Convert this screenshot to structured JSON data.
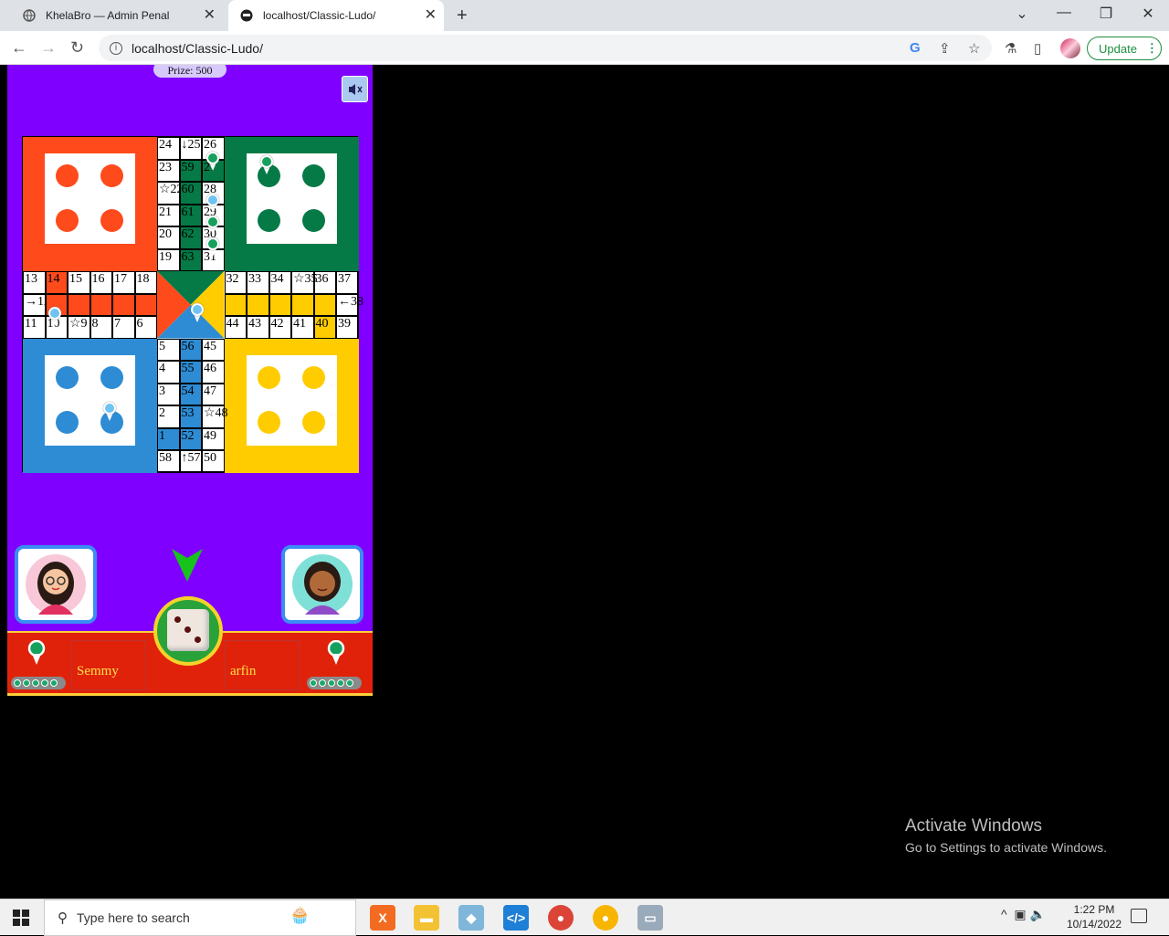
{
  "browser": {
    "tabs": [
      {
        "title": "KhelaBro — Admin Penal",
        "active": false
      },
      {
        "title": "localhost/Classic-Ludo/",
        "active": true
      }
    ],
    "url": "localhost/Classic-Ludo/",
    "update_label": "Update",
    "new_tab": "+",
    "minimize": "—",
    "maximize": "❐",
    "close": "✕"
  },
  "game": {
    "prize_label": "Prize: 500",
    "colors": {
      "red": "#ff4a1c",
      "green": "#057a46",
      "blue": "#2d8cd4",
      "yellow": "#ffcc00",
      "background": "#7f00ff"
    },
    "cells": {
      "top_col1": [
        "24",
        "23",
        "☆22",
        "21",
        "20",
        "19"
      ],
      "top_col2": [
        "↓25",
        "59",
        "60",
        "61",
        "62",
        "63"
      ],
      "top_col3": [
        "26",
        "27",
        "28",
        "29",
        "30",
        "31"
      ],
      "left_row1": [
        "13",
        "14",
        "15",
        "16",
        "17",
        "18"
      ],
      "left_row2": [
        "→12",
        "",
        "",
        "",
        "",
        ""
      ],
      "left_row3": [
        "11",
        "10",
        "☆9",
        "8",
        "7",
        "6"
      ],
      "right_row1": [
        "32",
        "33",
        "34",
        "☆35",
        "36",
        "37"
      ],
      "right_row2": [
        "",
        "",
        "",
        "",
        "",
        "←38"
      ],
      "right_row3": [
        "44",
        "43",
        "42",
        "41",
        "40",
        "39"
      ],
      "bottom_col1": [
        "5",
        "4",
        "3",
        "2",
        "1",
        "58"
      ],
      "bottom_col2": [
        "56",
        "55",
        "54",
        "53",
        "52",
        "↑57"
      ],
      "bottom_col3": [
        "45",
        "46",
        "47",
        "☆48",
        "49",
        "50"
      ]
    },
    "players": [
      {
        "name": "Semmy",
        "pawn_color": "#16a05d"
      },
      {
        "name": "arfin",
        "pawn_color": "#16a05d"
      }
    ],
    "dice_value": 3
  },
  "desktop": {
    "activate_title": "Activate Windows",
    "activate_sub": "Go to Settings to activate Windows.",
    "search_placeholder": "Type here to search",
    "time": "1:22 PM",
    "date": "10/14/2022"
  }
}
